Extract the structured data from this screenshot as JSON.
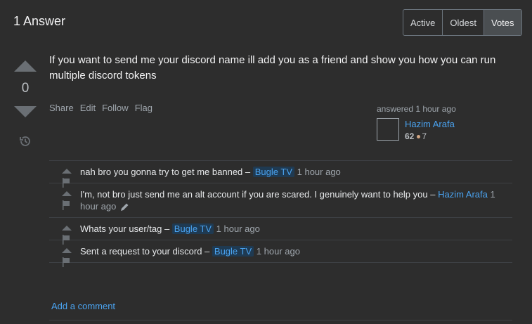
{
  "header": {
    "title": "1 Answer"
  },
  "sort": {
    "options": [
      "Active",
      "Oldest",
      "Votes"
    ],
    "selected": "Votes"
  },
  "answer": {
    "vote_count": "0",
    "body": "If you want to send me your discord name ill add you as a friend and show you how you can run multiple discord tokens",
    "menu": {
      "share": "Share",
      "edit": "Edit",
      "follow": "Follow",
      "flag": "Flag"
    },
    "author": {
      "action": "answered 1 hour ago",
      "name": "Hazim Arafa",
      "reputation": "62",
      "bronze_badges": "7"
    }
  },
  "comments": [
    {
      "text": "nah bro you gonna try to get me banned –",
      "user": "Bugle TV",
      "date": "1 hour ago"
    },
    {
      "text": "I'm, not bro just send me an alt account if you are scared. I genuinely want to help you –",
      "user": "Hazim Arafa",
      "date": "1 hour ago"
    },
    {
      "text": "Whats your user/tag –",
      "user": "Bugle TV",
      "date": "1 hour ago"
    },
    {
      "text": "Sent a request to your discord –",
      "user": "Bugle TV",
      "date": "1 hour ago"
    }
  ],
  "add_comment": "Add a comment",
  "icons": {
    "upvote": "upvote-arrow-icon",
    "downvote": "downvote-arrow-icon",
    "history": "history-icon",
    "flag": "flag-icon",
    "edit": "pencil-icon"
  },
  "colors": {
    "link": "#4aa3f0",
    "background": "#2d2d2d",
    "bronze": "#d1a684"
  }
}
